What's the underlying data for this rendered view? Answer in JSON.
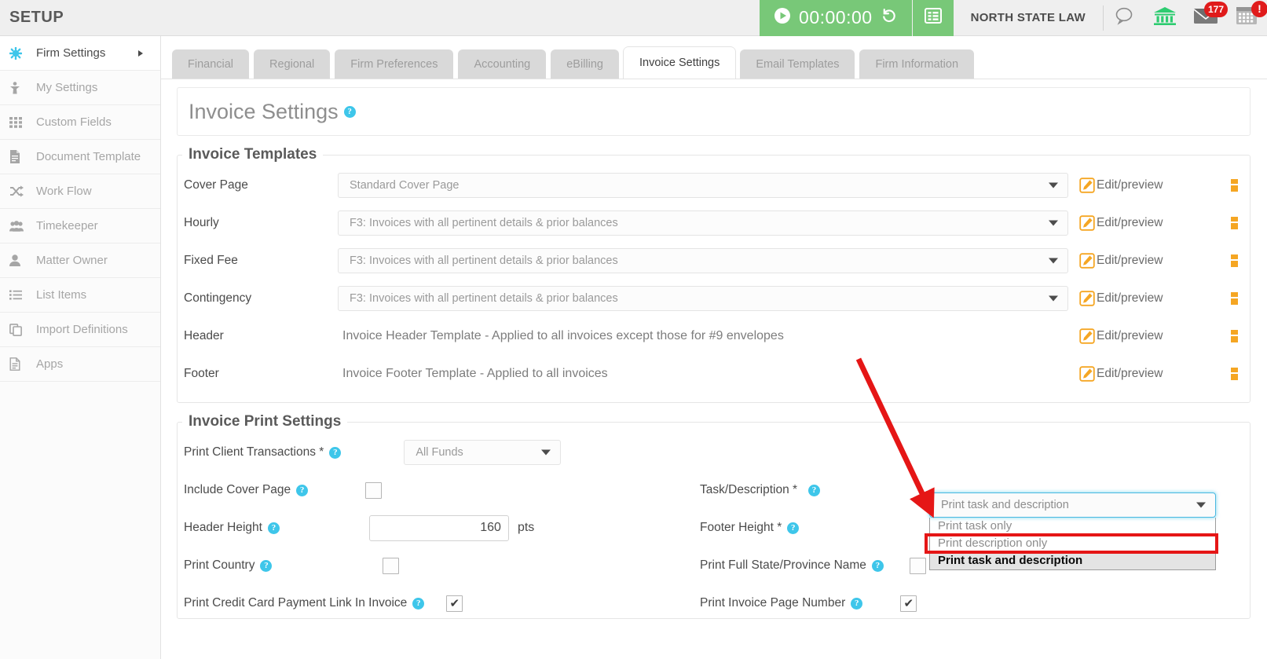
{
  "topbar": {
    "title": "SETUP",
    "timer": "00:00:00",
    "play_icon": "play-circle-icon",
    "reset_icon": "reset-icon",
    "grid_icon": "list-grid-icon",
    "firm_name": "NORTH STATE LAW",
    "chat_icon": "chat-bubble-icon",
    "bank_icon": "bank-icon",
    "mail_icon": "envelope-icon",
    "mail_badge": "177",
    "calendar_icon": "calendar-icon",
    "calendar_badge": "!"
  },
  "sidebar": {
    "items": [
      {
        "label": "Firm Settings",
        "icon": "gear-icon",
        "active": true,
        "caret": true
      },
      {
        "label": "My Settings",
        "icon": "person-settings-icon",
        "active": false,
        "caret": false
      },
      {
        "label": "Custom Fields",
        "icon": "grid-dots-icon",
        "active": false,
        "caret": false
      },
      {
        "label": "Document Template",
        "icon": "document-icon",
        "active": false,
        "caret": false
      },
      {
        "label": "Work Flow",
        "icon": "shuffle-icon",
        "active": false,
        "caret": false
      },
      {
        "label": "Timekeeper",
        "icon": "users-icon",
        "active": false,
        "caret": false
      },
      {
        "label": "Matter Owner",
        "icon": "user-icon",
        "active": false,
        "caret": false
      },
      {
        "label": "List Items",
        "icon": "list-icon",
        "active": false,
        "caret": false
      },
      {
        "label": "Import Definitions",
        "icon": "copy-icon",
        "active": false,
        "caret": false
      },
      {
        "label": "Apps",
        "icon": "file-icon",
        "active": false,
        "caret": false
      }
    ]
  },
  "tabs": [
    {
      "label": "Financial",
      "active": false
    },
    {
      "label": "Regional",
      "active": false
    },
    {
      "label": "Firm Preferences",
      "active": false
    },
    {
      "label": "Accounting",
      "active": false
    },
    {
      "label": "eBilling",
      "active": false
    },
    {
      "label": "Invoice Settings",
      "active": true
    },
    {
      "label": "Email Templates",
      "active": false
    },
    {
      "label": "Firm Information",
      "active": false
    }
  ],
  "page": {
    "title": "Invoice Settings",
    "help_icon": "help-icon"
  },
  "templates_section": {
    "legend": "Invoice Templates",
    "edit_link_label": "Edit/preview",
    "edit_icon": "pencil-edit-icon",
    "extra_icon": "clipboard-copy-icon",
    "rows": [
      {
        "label": "Cover Page",
        "value": "Standard Cover Page",
        "control": "dropdown"
      },
      {
        "label": "Hourly",
        "value": "F3: Invoices with all pertinent details & prior balances",
        "control": "dropdown"
      },
      {
        "label": "Fixed Fee",
        "value": "F3: Invoices with all pertinent details & prior balances",
        "control": "dropdown"
      },
      {
        "label": "Contingency",
        "value": "F3: Invoices with all pertinent details & prior balances",
        "control": "dropdown"
      },
      {
        "label": "Header",
        "value": "Invoice Header Template - Applied to all invoices except those for #9 envelopes",
        "control": "text"
      },
      {
        "label": "Footer",
        "value": "Invoice Footer Template - Applied to all invoices",
        "control": "text"
      }
    ]
  },
  "print_section": {
    "legend": "Invoice Print Settings",
    "left_rows": [
      {
        "label": "Print Client Transactions *",
        "control": "dropdown",
        "value": "All Funds",
        "help": true
      },
      {
        "label": "Include Cover Page",
        "control": "checkbox",
        "checked": false,
        "help": true
      },
      {
        "label": "Header Height",
        "control": "textbox",
        "value": "160",
        "units": "pts",
        "help": true
      },
      {
        "label": "Print Country",
        "control": "checkbox",
        "checked": false,
        "help": true
      },
      {
        "label": "Print Credit Card Payment Link In Invoice",
        "control": "checkbox",
        "checked": true,
        "help": true
      }
    ],
    "right_rows": [
      {
        "label": "Task/Description *",
        "control": "open-select",
        "help": true
      },
      {
        "label": "Footer Height *",
        "control": "none",
        "help": true
      },
      {
        "label": "Print Full State/Province Name",
        "control": "checkbox",
        "checked": false,
        "help": true
      },
      {
        "label": "Print Invoice Page Number",
        "control": "checkbox",
        "checked": true,
        "help": true
      }
    ]
  },
  "task_description_select": {
    "selected_display": "Print task and description",
    "options": [
      {
        "label": "Print task only",
        "selected": false
      },
      {
        "label": "Print description only",
        "selected": false,
        "highlighted_by_annotation": true
      },
      {
        "label": "Print task and description",
        "selected": true
      }
    ]
  },
  "annotations": {
    "arrow": {
      "name": "red-arrow-annotation",
      "color": "#e51616",
      "from": [
        1093,
        457
      ],
      "to": [
        1188,
        657
      ]
    },
    "highlight_box": {
      "name": "red-highlight-box-annotation",
      "color": "#e51616",
      "target_option": "Print description only"
    }
  },
  "colors": {
    "timer_green": "#78c878",
    "accent_blue": "#3ec6ea",
    "badge_red": "#e01b1b",
    "annotation_red": "#e51616",
    "edit_orange": "#f5a623",
    "topbar_bg": "#efefef"
  }
}
